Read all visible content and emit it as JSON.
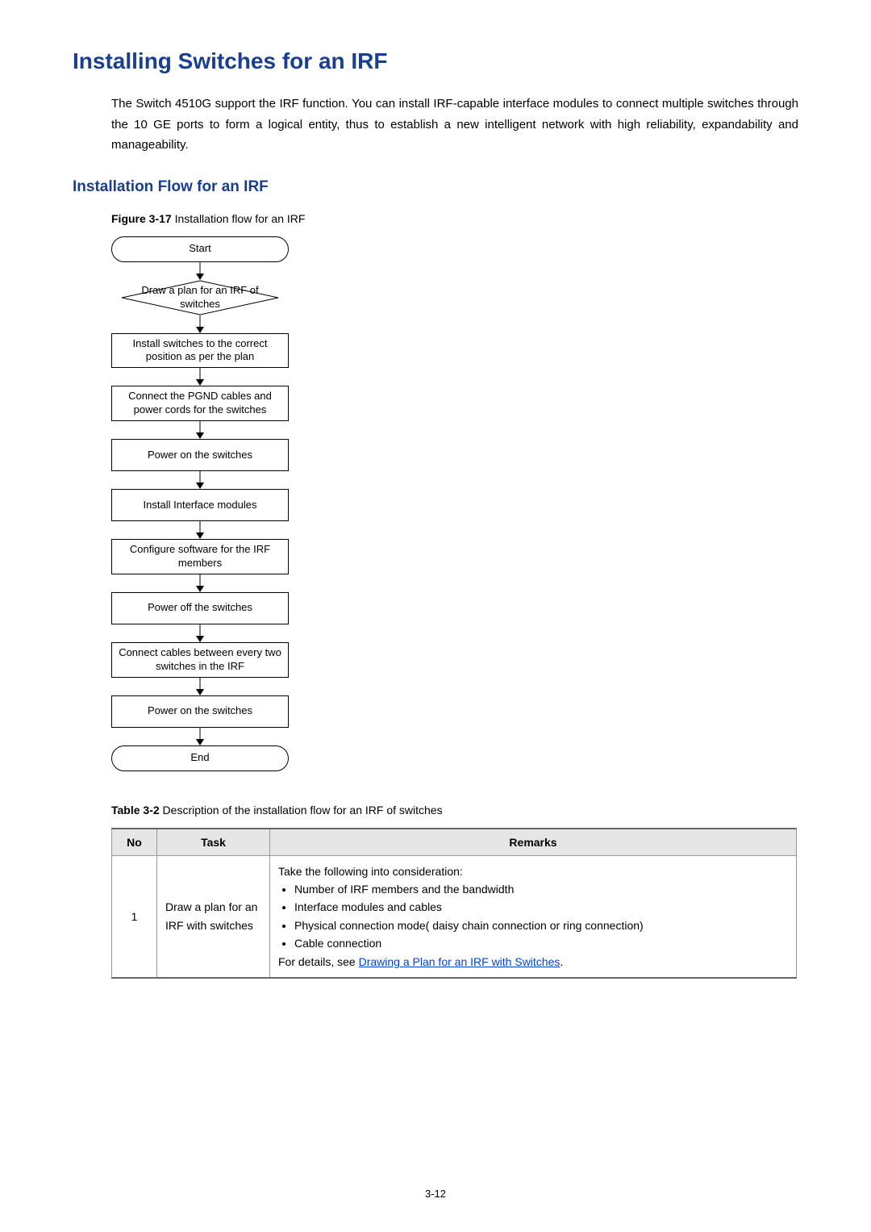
{
  "heading": "Installing Switches for an IRF",
  "intro": "The Switch 4510G support the IRF function. You can install IRF-capable interface modules to connect multiple switches through the 10 GE ports to form a logical entity, thus to establish a new intelligent network with high reliability, expandability and manageability.",
  "subheading": "Installation Flow for an IRF",
  "figure": {
    "label": "Figure 3-17",
    "title": "Installation flow for an IRF"
  },
  "flow": {
    "start": "Start",
    "decision": "Draw a plan for an IRF of switches",
    "steps": [
      "Install switches to the correct position as per the plan",
      "Connect the PGND cables and power cords for the switches",
      "Power on the switches",
      "Install Interface modules",
      "Configure software for the IRF members",
      "Power off the switches",
      "Connect cables between every two switches in the IRF",
      "Power on the switches"
    ],
    "end": "End"
  },
  "table": {
    "label": "Table 3-2",
    "title": "Description of the installation flow for an IRF of switches",
    "headers": {
      "no": "No",
      "task": "Task",
      "remarks": "Remarks"
    },
    "row": {
      "no": "1",
      "task": "Draw a plan for an IRF with switches",
      "remarks_lead": "Take the following into consideration:",
      "bullets": [
        "Number of IRF members and the bandwidth",
        "Interface modules and cables",
        "Physical connection mode( daisy chain connection or ring connection)",
        "Cable connection"
      ],
      "remarks_trail_pre": "For details, see ",
      "remarks_link": "Drawing a Plan for an IRF with Switches",
      "remarks_trail_post": "."
    }
  },
  "page_number": "3-12"
}
